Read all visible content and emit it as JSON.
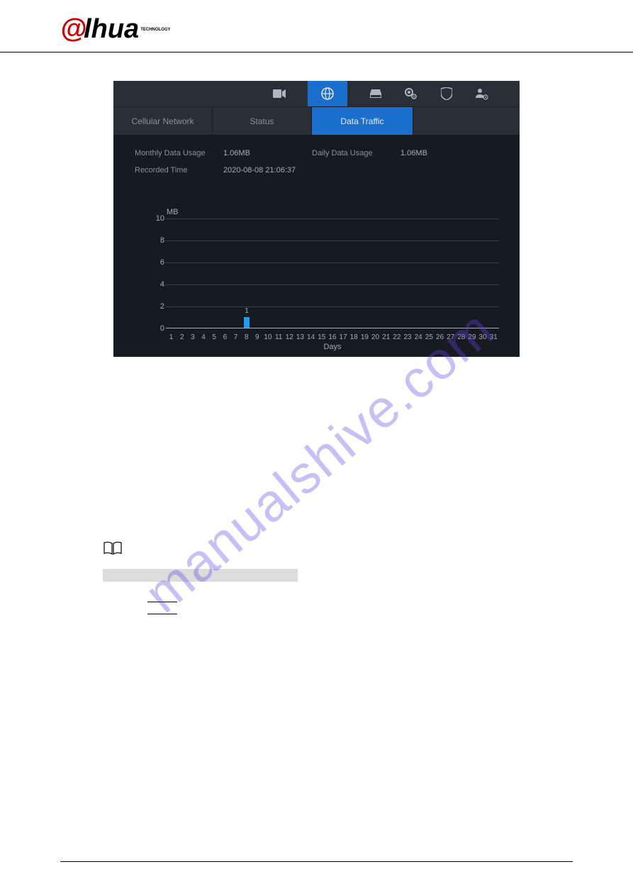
{
  "logo": {
    "prefix": "@",
    "text": "lhua",
    "subtitle": "TECHNOLOGY"
  },
  "screenshot": {
    "tabs": [
      {
        "label": "Cellular Network",
        "active": false
      },
      {
        "label": "Status",
        "active": false
      },
      {
        "label": "Data Traffic",
        "active": true
      }
    ],
    "stats": {
      "monthly_label": "Monthly Data Usage",
      "monthly_value": "1.06MB",
      "daily_label": "Daily Data Usage",
      "daily_value": "1.06MB",
      "recorded_label": "Recorded Time",
      "recorded_value": "2020-08-08 21:06:37"
    }
  },
  "chart_data": {
    "type": "bar",
    "unit": "MB",
    "categories": [
      "1",
      "2",
      "3",
      "4",
      "5",
      "6",
      "7",
      "8",
      "9",
      "10",
      "11",
      "12",
      "13",
      "14",
      "15",
      "16",
      "17",
      "18",
      "19",
      "20",
      "21",
      "22",
      "23",
      "24",
      "25",
      "26",
      "27",
      "28",
      "29",
      "30",
      "31"
    ],
    "values": [
      0,
      0,
      0,
      0,
      0,
      0,
      0,
      1,
      0,
      0,
      0,
      0,
      0,
      0,
      0,
      0,
      0,
      0,
      0,
      0,
      0,
      0,
      0,
      0,
      0,
      0,
      0,
      0,
      0,
      0,
      0
    ],
    "bar_labels": {
      "8": "1"
    },
    "xlabel": "Days",
    "ylabel": "",
    "ylim": [
      0,
      10
    ],
    "yticks": [
      0,
      2,
      4,
      6,
      8,
      10
    ]
  },
  "watermark": {
    "text": "manualshive.com"
  }
}
